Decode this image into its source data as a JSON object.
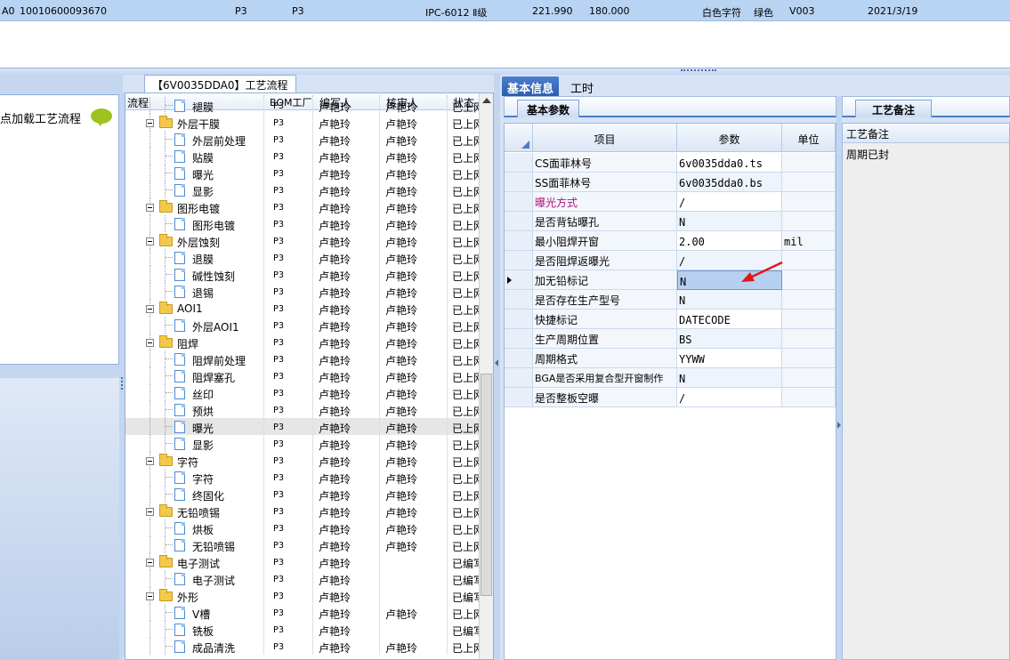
{
  "top_row": {
    "code_prefix": "A0",
    "code": "10010600093670",
    "factory1": "P3",
    "factory2": "P3",
    "grade": "IPC-6012 Ⅱ级",
    "num1": "221.990",
    "num2": "180.000",
    "char_color": "白色字符",
    "mask_color": "绿色",
    "version": "V003",
    "date": "2021/3/19"
  },
  "left_panel": {
    "load_text": "点加载工艺流程",
    "bubble_icon": "chat-bubble-icon",
    "bubble_color": "#9cc320"
  },
  "tree_panel": {
    "caption": "【6V0035DDA0】工艺流程",
    "headers": [
      "流程",
      "BOM工厂",
      "编写人",
      "核审人",
      "状态"
    ],
    "rows": [
      {
        "level": 1,
        "type": "doc",
        "name": "褪膜",
        "bom": "P3",
        "writer": "卢艳玲",
        "reviewer": "卢艳玲",
        "status": "已上网"
      },
      {
        "level": 0,
        "type": "folder",
        "name": "外层干膜",
        "bom": "P3",
        "writer": "卢艳玲",
        "reviewer": "卢艳玲",
        "status": "已上网"
      },
      {
        "level": 1,
        "type": "doc",
        "name": "外层前处理",
        "bom": "P3",
        "writer": "卢艳玲",
        "reviewer": "卢艳玲",
        "status": "已上网"
      },
      {
        "level": 1,
        "type": "doc",
        "name": "贴膜",
        "bom": "P3",
        "writer": "卢艳玲",
        "reviewer": "卢艳玲",
        "status": "已上网"
      },
      {
        "level": 1,
        "type": "doc",
        "name": "曝光",
        "bom": "P3",
        "writer": "卢艳玲",
        "reviewer": "卢艳玲",
        "status": "已上网"
      },
      {
        "level": 1,
        "type": "doc",
        "name": "显影",
        "bom": "P3",
        "writer": "卢艳玲",
        "reviewer": "卢艳玲",
        "status": "已上网"
      },
      {
        "level": 0,
        "type": "folder",
        "name": "图形电镀",
        "bom": "P3",
        "writer": "卢艳玲",
        "reviewer": "卢艳玲",
        "status": "已上网"
      },
      {
        "level": 1,
        "type": "doc",
        "name": "图形电镀",
        "bom": "P3",
        "writer": "卢艳玲",
        "reviewer": "卢艳玲",
        "status": "已上网"
      },
      {
        "level": 0,
        "type": "folder",
        "name": "外层蚀刻",
        "bom": "P3",
        "writer": "卢艳玲",
        "reviewer": "卢艳玲",
        "status": "已上网"
      },
      {
        "level": 1,
        "type": "doc",
        "name": "退膜",
        "bom": "P3",
        "writer": "卢艳玲",
        "reviewer": "卢艳玲",
        "status": "已上网"
      },
      {
        "level": 1,
        "type": "doc",
        "name": "碱性蚀刻",
        "bom": "P3",
        "writer": "卢艳玲",
        "reviewer": "卢艳玲",
        "status": "已上网"
      },
      {
        "level": 1,
        "type": "doc",
        "name": "退锡",
        "bom": "P3",
        "writer": "卢艳玲",
        "reviewer": "卢艳玲",
        "status": "已上网"
      },
      {
        "level": 0,
        "type": "folder",
        "name": "AOI1",
        "bom": "P3",
        "writer": "卢艳玲",
        "reviewer": "卢艳玲",
        "status": "已上网"
      },
      {
        "level": 1,
        "type": "doc",
        "name": "外层AOI1",
        "bom": "P3",
        "writer": "卢艳玲",
        "reviewer": "卢艳玲",
        "status": "已上网"
      },
      {
        "level": 0,
        "type": "folder",
        "name": "阻焊",
        "bom": "P3",
        "writer": "卢艳玲",
        "reviewer": "卢艳玲",
        "status": "已上网"
      },
      {
        "level": 1,
        "type": "doc",
        "name": "阻焊前处理",
        "bom": "P3",
        "writer": "卢艳玲",
        "reviewer": "卢艳玲",
        "status": "已上网"
      },
      {
        "level": 1,
        "type": "doc",
        "name": "阻焊塞孔",
        "bom": "P3",
        "writer": "卢艳玲",
        "reviewer": "卢艳玲",
        "status": "已上网"
      },
      {
        "level": 1,
        "type": "doc",
        "name": "丝印",
        "bom": "P3",
        "writer": "卢艳玲",
        "reviewer": "卢艳玲",
        "status": "已上网"
      },
      {
        "level": 1,
        "type": "doc",
        "name": "预烘",
        "bom": "P3",
        "writer": "卢艳玲",
        "reviewer": "卢艳玲",
        "status": "已上网"
      },
      {
        "level": 1,
        "type": "doc",
        "name": "曝光",
        "bom": "P3",
        "writer": "卢艳玲",
        "reviewer": "卢艳玲",
        "status": "已上网",
        "selected": true
      },
      {
        "level": 1,
        "type": "doc",
        "name": "显影",
        "bom": "P3",
        "writer": "卢艳玲",
        "reviewer": "卢艳玲",
        "status": "已上网"
      },
      {
        "level": 0,
        "type": "folder",
        "name": "字符",
        "bom": "P3",
        "writer": "卢艳玲",
        "reviewer": "卢艳玲",
        "status": "已上网"
      },
      {
        "level": 1,
        "type": "doc",
        "name": "字符",
        "bom": "P3",
        "writer": "卢艳玲",
        "reviewer": "卢艳玲",
        "status": "已上网"
      },
      {
        "level": 1,
        "type": "doc",
        "name": "终固化",
        "bom": "P3",
        "writer": "卢艳玲",
        "reviewer": "卢艳玲",
        "status": "已上网"
      },
      {
        "level": 0,
        "type": "folder",
        "name": "无铅喷锡",
        "bom": "P3",
        "writer": "卢艳玲",
        "reviewer": "卢艳玲",
        "status": "已上网"
      },
      {
        "level": 1,
        "type": "doc",
        "name": "烘板",
        "bom": "P3",
        "writer": "卢艳玲",
        "reviewer": "卢艳玲",
        "status": "已上网"
      },
      {
        "level": 1,
        "type": "doc",
        "name": "无铅喷锡",
        "bom": "P3",
        "writer": "卢艳玲",
        "reviewer": "卢艳玲",
        "status": "已上网"
      },
      {
        "level": 0,
        "type": "folder",
        "name": "电子测试",
        "bom": "P3",
        "writer": "卢艳玲",
        "reviewer": "",
        "status": "已编写"
      },
      {
        "level": 1,
        "type": "doc",
        "name": "电子测试",
        "bom": "P3",
        "writer": "卢艳玲",
        "reviewer": "",
        "status": "已编写"
      },
      {
        "level": 0,
        "type": "folder",
        "name": "外形",
        "bom": "P3",
        "writer": "卢艳玲",
        "reviewer": "",
        "status": "已编写"
      },
      {
        "level": 1,
        "type": "doc",
        "name": "V槽",
        "bom": "P3",
        "writer": "卢艳玲",
        "reviewer": "卢艳玲",
        "status": "已上网"
      },
      {
        "level": 1,
        "type": "doc",
        "name": "铣板",
        "bom": "P3",
        "writer": "卢艳玲",
        "reviewer": "",
        "status": "已编写"
      },
      {
        "level": 1,
        "type": "doc",
        "name": "成品清洗",
        "bom": "P3",
        "writer": "卢艳玲",
        "reviewer": "卢艳玲",
        "status": "已上网"
      }
    ]
  },
  "tabs": [
    {
      "label": "基本信息",
      "active": true
    },
    {
      "label": "工时",
      "active": false
    }
  ],
  "sub_tab": "基本参数",
  "grid": {
    "headers": {
      "item": "项目",
      "param": "参数",
      "unit": "单位"
    },
    "rows": [
      {
        "item": "CS面菲林号",
        "value": "6v0035dda0.ts",
        "unit": ""
      },
      {
        "item": "SS面菲林号",
        "value": "6v0035dda0.bs",
        "unit": ""
      },
      {
        "item": "曝光方式",
        "value": "/",
        "unit": "",
        "highlight": true
      },
      {
        "item": "是否背钻曝孔",
        "value": "N",
        "unit": ""
      },
      {
        "item": "最小阻焊开窗",
        "value": "2.00",
        "unit": "mil"
      },
      {
        "item": "是否阻焊返曝光",
        "value": "/",
        "unit": ""
      },
      {
        "item": "加无铅标记",
        "value": "N",
        "unit": "",
        "current": true
      },
      {
        "item": "是否存在生产型号",
        "value": "N",
        "unit": ""
      },
      {
        "item": "快捷标记",
        "value": "DATECODE",
        "unit": ""
      },
      {
        "item": "生产周期位置",
        "value": "BS",
        "unit": ""
      },
      {
        "item": "周期格式",
        "value": "YYWW",
        "unit": ""
      },
      {
        "item": "BGA是否采用复合型开窗制作",
        "value": "N",
        "unit": ""
      },
      {
        "item": "是否整板空曝",
        "value": "/",
        "unit": ""
      }
    ],
    "highlight_color": "#b0127a",
    "pointer_color": "#e01818"
  },
  "remark": {
    "tab": "工艺备注",
    "header": "工艺备注",
    "value": "周期已封"
  }
}
